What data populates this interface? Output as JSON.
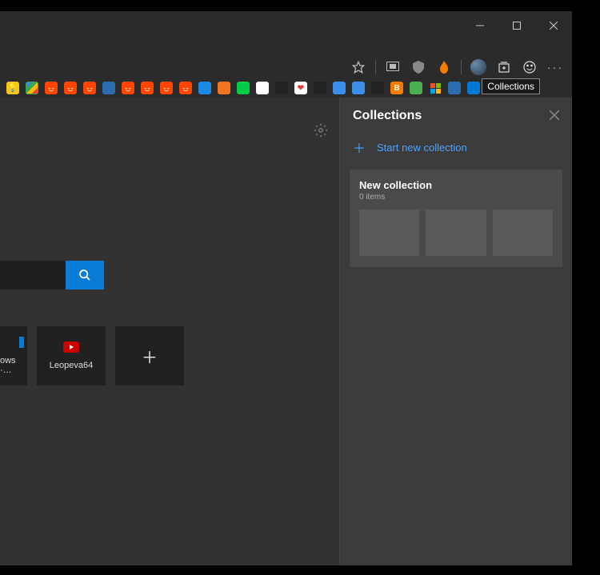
{
  "window": {
    "controls": {
      "min": "minimize",
      "max": "maximize",
      "close": "close"
    }
  },
  "toolbar": {
    "favorite": "favorite-star",
    "media": "media-cast",
    "shield": "privacy-shield",
    "ext1": "extension-flame",
    "profile": "profile-avatar",
    "collections": "collections",
    "feedback": "feedback-smiley",
    "menu": "more-menu"
  },
  "tooltip": {
    "collections": "Collections"
  },
  "bookmarks": [
    {
      "n": "bulb",
      "bg": "#f5c518",
      "fg": "#000"
    },
    {
      "n": "maps",
      "bg": "#34a853",
      "fg": "#fff"
    },
    {
      "n": "reddit1",
      "bg": "#ff4500",
      "fg": "#fff"
    },
    {
      "n": "reddit2",
      "bg": "#ff4500",
      "fg": "#fff"
    },
    {
      "n": "reddit3",
      "bg": "#ff4500",
      "fg": "#fff"
    },
    {
      "n": "flask",
      "bg": "#2b6cb0",
      "fg": "#fff"
    },
    {
      "n": "reddit4",
      "bg": "#ff4500",
      "fg": "#fff"
    },
    {
      "n": "reddit5",
      "bg": "#ff4500",
      "fg": "#fff"
    },
    {
      "n": "reddit6",
      "bg": "#ff4500",
      "fg": "#fff"
    },
    {
      "n": "pin",
      "bg": "#ff4500",
      "fg": "#fff"
    },
    {
      "n": "wave",
      "bg": "#1e88e5",
      "fg": "#fff"
    },
    {
      "n": "crunchy",
      "bg": "#f47521",
      "fg": "#fff"
    },
    {
      "n": "deviant",
      "bg": "#05cc47",
      "fg": "#000"
    },
    {
      "n": "doc",
      "bg": "#ffffff",
      "fg": "#000"
    },
    {
      "n": "amazon",
      "bg": "#222",
      "fg": "#ff9900"
    },
    {
      "n": "heart",
      "bg": "#fff",
      "fg": "#e53935"
    },
    {
      "n": "uo",
      "bg": "#222",
      "fg": "#e53935"
    },
    {
      "n": "win1",
      "bg": "#3b8eea",
      "fg": "#fff"
    },
    {
      "n": "win2",
      "bg": "#3b8eea",
      "fg": "#fff"
    },
    {
      "n": "hub",
      "bg": "#222",
      "fg": "#fff"
    },
    {
      "n": "blogger",
      "bg": "#f57c00",
      "fg": "#fff"
    },
    {
      "n": "pen",
      "bg": "#4caf50",
      "fg": "#fff"
    },
    {
      "n": "msft",
      "bg": "transparent",
      "fg": "#fff"
    },
    {
      "n": "docs",
      "bg": "#2b6cb0",
      "fg": "#fff"
    },
    {
      "n": "edge",
      "bg": "#0078d4",
      "fg": "#fff"
    },
    {
      "n": "play",
      "bg": "#0288d1",
      "fg": "#fff"
    },
    {
      "n": "gear",
      "bg": "#555",
      "fg": "#ccc"
    }
  ],
  "main": {
    "search_placeholder": "",
    "tile1_label_fragment": "ows ·…",
    "tile2_label": "Leopeva64"
  },
  "panel": {
    "title": "Collections",
    "start_label": "Start new collection",
    "card": {
      "title": "New collection",
      "items_count": "0 items"
    }
  }
}
